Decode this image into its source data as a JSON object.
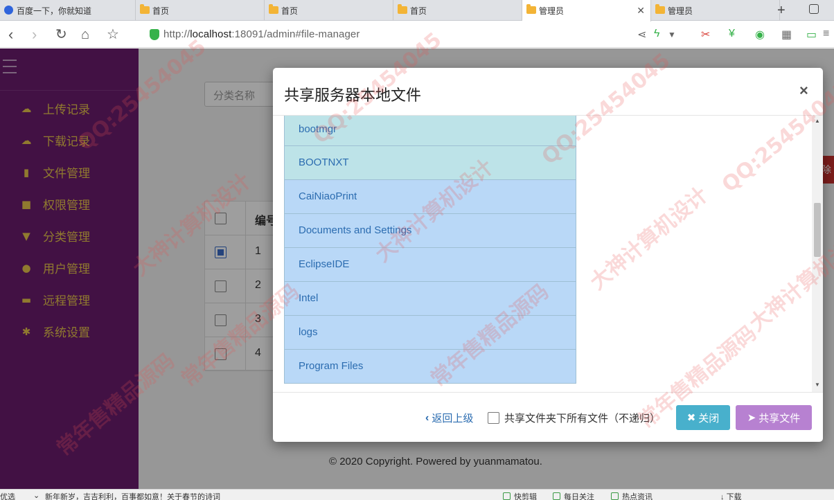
{
  "browser": {
    "tabs": [
      {
        "label": "百度一下，你就知道",
        "icon": "baidu-paw-icon",
        "active": false
      },
      {
        "label": "首页",
        "icon": "folder-icon",
        "active": false
      },
      {
        "label": "首页",
        "icon": "folder-icon",
        "active": false
      },
      {
        "label": "首页",
        "icon": "folder-icon",
        "active": false
      },
      {
        "label": "管理员",
        "icon": "folder-icon",
        "active": true
      },
      {
        "label": "管理员",
        "icon": "folder-icon",
        "active": false
      }
    ],
    "url_prefix": "http://",
    "url_host": "localhost",
    "url_rest": ":18091/admin#file-manager"
  },
  "sidebar": {
    "items": [
      {
        "label": "上传记录",
        "icon": "cloud-upload-icon"
      },
      {
        "label": "下载记录",
        "icon": "cloud-download-icon"
      },
      {
        "label": "文件管理",
        "icon": "file-icon"
      },
      {
        "label": "权限管理",
        "icon": "lock-icon"
      },
      {
        "label": "分类管理",
        "icon": "filter-icon"
      },
      {
        "label": "用户管理",
        "icon": "user-icon"
      },
      {
        "label": "远程管理",
        "icon": "briefcase-icon"
      },
      {
        "label": "系统设置",
        "icon": "gear-icon"
      }
    ]
  },
  "main": {
    "search_placeholder": "分类名称",
    "delete_label": "除",
    "table": {
      "header": "编号",
      "rows": [
        {
          "id": "1",
          "checked": true
        },
        {
          "id": "2",
          "checked": false
        },
        {
          "id": "3",
          "checked": false
        },
        {
          "id": "4",
          "checked": false
        }
      ]
    },
    "footer": "© 2020 Copyright.    Powered by yuanmamatou."
  },
  "modal": {
    "title": "共享服务器本地文件",
    "close_symbol": "×",
    "files": [
      "bootmgr",
      "BOOTNXT",
      "CaiNiaoPrint",
      "Documents and Settings",
      "EclipseIDE",
      "Intel",
      "logs",
      "Program Files"
    ],
    "back_label": "返回上级",
    "share_all_label": "共享文件夹下所有文件（不递归）",
    "close_button": "关闭",
    "share_button": "共享文件"
  },
  "statusbar": {
    "left": "优选",
    "news": "新年新岁，吉吉利利，百事都如意！关于春节的诗词",
    "items": [
      "快剪辑",
      "每日关注",
      "热点资讯",
      "下载"
    ]
  },
  "watermark": {
    "texts": [
      "QQ:25454045",
      "大神计算机设计",
      "常年售精品源码",
      "QQ:25454045",
      "大神计算机设计",
      "常年售精品源码",
      "QQ:25454045",
      "大神计算机设计",
      "常年售精品源码",
      "QQ:25454045",
      "大神计算机设计",
      "常年售精品源码"
    ]
  },
  "colors": {
    "sidebar_bg": "#6b1c6f",
    "sidebar_text": "#e8c64c",
    "close_btn": "#48b0cc",
    "share_btn": "#b781d1",
    "file_item_bg": "#b9d8f7"
  }
}
